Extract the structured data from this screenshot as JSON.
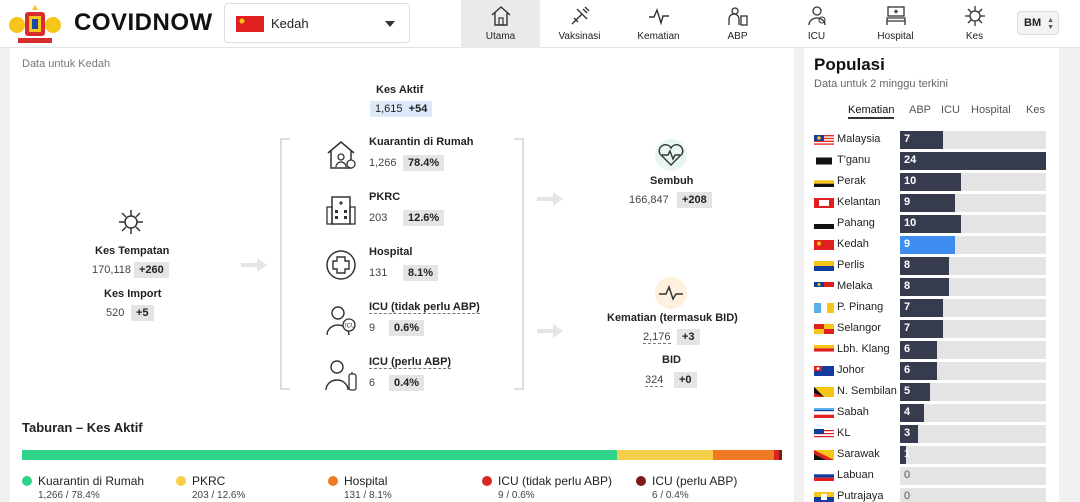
{
  "header": {
    "brand": "COVIDNOW",
    "state_select": {
      "value": "Kedah"
    },
    "nav": [
      {
        "id": "utama",
        "label": "Utama",
        "active": true,
        "icon": "home-icon"
      },
      {
        "id": "vaksinasi",
        "label": "Vaksinasi",
        "active": false,
        "icon": "syringe-icon"
      },
      {
        "id": "kematian",
        "label": "Kematian",
        "active": false,
        "icon": "pulse-icon"
      },
      {
        "id": "abp",
        "label": "ABP",
        "active": false,
        "icon": "ventilator-icon"
      },
      {
        "id": "icu",
        "label": "ICU",
        "active": false,
        "icon": "icu-patient-icon"
      },
      {
        "id": "hospital",
        "label": "Hospital",
        "active": false,
        "icon": "hospital-bed-icon"
      },
      {
        "id": "kes",
        "label": "Kes",
        "active": false,
        "icon": "virus-icon"
      }
    ],
    "language": "BM"
  },
  "main": {
    "data_for": "Data untuk Kedah",
    "kes_aktif": {
      "label": "Kes Aktif",
      "value": "1,615",
      "delta": "+54"
    },
    "kes_tempatan": {
      "label": "Kes Tempatan",
      "value": "170,118",
      "delta": "+260"
    },
    "kes_import": {
      "label": "Kes Import",
      "value": "520",
      "delta": "+5"
    },
    "breakdown": [
      {
        "label": "Kuarantin di Rumah",
        "value": "1,266",
        "pct": "78.4%",
        "icon": "home-quarantine-icon"
      },
      {
        "label": "PKRC",
        "value": "203",
        "pct": "12.6%",
        "icon": "quarantine-center-icon"
      },
      {
        "label": "Hospital",
        "value": "131",
        "pct": "8.1%",
        "icon": "hospital-cross-icon"
      },
      {
        "label": "ICU (tidak perlu ABP)",
        "value": "9",
        "pct": "0.6%",
        "icon": "icu-nurse-icon"
      },
      {
        "label": "ICU (perlu ABP)",
        "value": "6",
        "pct": "0.4%",
        "icon": "icu-ventilator-icon"
      }
    ],
    "sembuh": {
      "label": "Sembuh",
      "value": "166,847",
      "delta": "+208"
    },
    "kematian": {
      "label": "Kematian (termasuk BID)",
      "value": "2,176",
      "delta": "+3"
    },
    "bid": {
      "label": "BID",
      "value": "324",
      "delta": "+0"
    },
    "distribution": {
      "title": "Taburan – Kes Aktif",
      "segments": [
        {
          "label": "Kuarantin di Rumah",
          "value_text": "1,266 / 78.4%",
          "fraction": 0.784,
          "color": "#2fd38a"
        },
        {
          "label": "PKRC",
          "value_text": "203 / 12.6%",
          "fraction": 0.126,
          "color": "#f6cf4a"
        },
        {
          "label": "Hospital",
          "value_text": "131 / 8.1%",
          "fraction": 0.081,
          "color": "#f07a24"
        },
        {
          "label": "ICU (tidak perlu ABP)",
          "value_text": "9 / 0.6%",
          "fraction": 0.006,
          "color": "#d62828"
        },
        {
          "label": "ICU (perlu ABP)",
          "value_text": "6 / 0.4%",
          "fraction": 0.004,
          "color": "#7d1a1a"
        }
      ]
    }
  },
  "right": {
    "title": "Populasi",
    "subtitle": "Data untuk 2 minggu terkini",
    "tabs": [
      "Kematian",
      "ABP",
      "ICU",
      "Hospital",
      "Kes"
    ],
    "active_tab": "Kematian",
    "max": 24,
    "states": [
      {
        "name": "Malaysia",
        "value": 7
      },
      {
        "name": "T'ganu",
        "value": 24
      },
      {
        "name": "Perak",
        "value": 10
      },
      {
        "name": "Kelantan",
        "value": 9
      },
      {
        "name": "Pahang",
        "value": 10
      },
      {
        "name": "Kedah",
        "value": 9,
        "highlight": true
      },
      {
        "name": "Perlis",
        "value": 8
      },
      {
        "name": "Melaka",
        "value": 8
      },
      {
        "name": "P. Pinang",
        "value": 7
      },
      {
        "name": "Selangor",
        "value": 7
      },
      {
        "name": "Lbh. Klang",
        "value": 6
      },
      {
        "name": "Johor",
        "value": 6
      },
      {
        "name": "N. Sembilan",
        "value": 5
      },
      {
        "name": "Sabah",
        "value": 4
      },
      {
        "name": "KL",
        "value": 3
      },
      {
        "name": "Sarawak",
        "value": 1
      },
      {
        "name": "Labuan",
        "value": 0
      },
      {
        "name": "Putrajaya",
        "value": 0
      }
    ]
  },
  "colors": {
    "bar": "#363c4d",
    "bar_highlight": "#3d8ef0",
    "track": "#e4e4e4"
  }
}
